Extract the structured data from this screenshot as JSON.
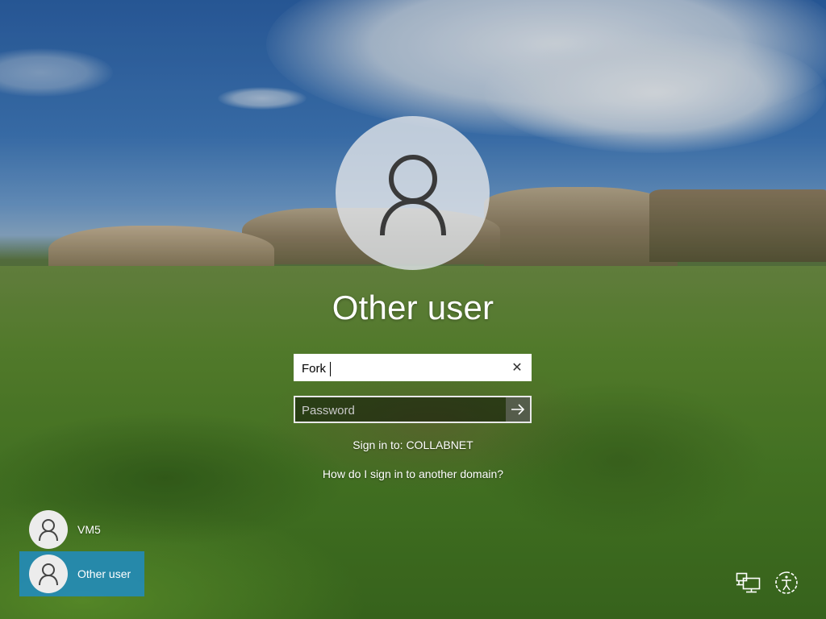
{
  "login": {
    "user_title": "Other user",
    "username_value": "Fork",
    "password_placeholder": "Password",
    "sign_in_to": "Sign in to: COLLABNET",
    "domain_help_link": "How do I sign in to another domain?"
  },
  "user_list": [
    {
      "label": "VM5",
      "selected": false
    },
    {
      "label": "Other user",
      "selected": true
    }
  ],
  "icons": {
    "large_avatar": "user-avatar-icon",
    "clear": "close-icon",
    "submit": "arrow-right-icon",
    "network": "network-icon",
    "accessibility": "ease-of-access-icon"
  },
  "colors": {
    "selected_tile": "#1e8cc8",
    "field_border": "#ffffff"
  }
}
